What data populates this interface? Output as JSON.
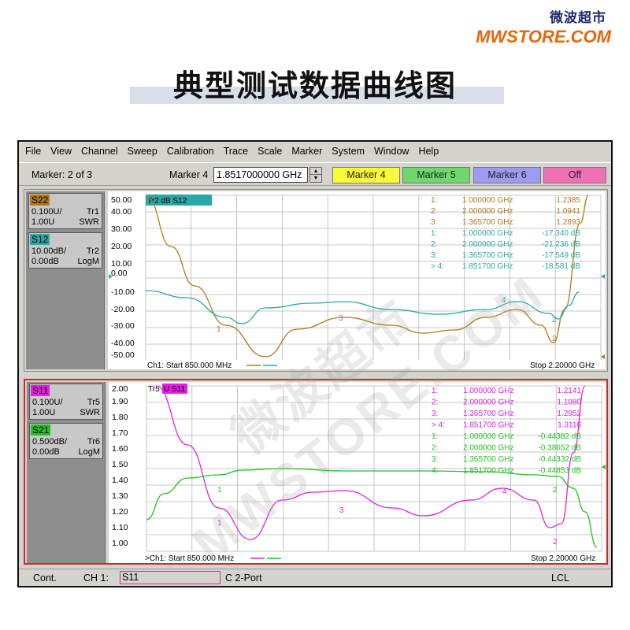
{
  "branding": {
    "name_cn": "微波超市",
    "name_en": "MWSTORE.COM"
  },
  "title": "典型测试数据曲线图",
  "menubar": [
    "File",
    "View",
    "Channel",
    "Sweep",
    "Calibration",
    "Trace",
    "Scale",
    "Marker",
    "System",
    "Window",
    "Help"
  ],
  "marker_bar": {
    "status": "Marker: 2 of 3",
    "label": "Marker 4",
    "value": "1.8517000000 GHz",
    "buttons": [
      "Marker 4",
      "Marker 5",
      "Marker 6",
      "Off"
    ]
  },
  "channel1": {
    "traces": [
      {
        "name": "S22",
        "scale": "0.100U/",
        "tr": "Tr1",
        "ref": "1.00U",
        "format": "SWR",
        "color": "#b07a1c"
      },
      {
        "name": "S12",
        "scale": "10.00dB/",
        "tr": "Tr2",
        "ref": "0.00dB",
        "format": "LogM",
        "color": "#2aa8a8"
      }
    ],
    "active_label": "Tr2 dB S12",
    "y_ticks": [
      "50.00",
      "40.00",
      "30.00",
      "20.00",
      "10.00",
      "0.00",
      "-10.00",
      "-20.00",
      "-30.00",
      "-40.00",
      "-50.00"
    ],
    "start": "Ch1: Start  850.000 MHz",
    "stop": "Stop  2.20000 GHz",
    "marker_readout": [
      {
        "id": "1:",
        "freq": "1.000000 GHz",
        "val": "1.2385",
        "color": "#b07a1c"
      },
      {
        "id": "2:",
        "freq": "2.000000 GHz",
        "val": "1.0941",
        "color": "#b07a1c"
      },
      {
        "id": "3:",
        "freq": "1.365700 GHz",
        "val": "1.2893",
        "color": "#b07a1c"
      },
      {
        "id": "1:",
        "freq": "1.000000 GHz",
        "val": "-17.340 dB",
        "color": "#2aa8a8"
      },
      {
        "id": "2:",
        "freq": "2.000000 GHz",
        "val": "-21.236 dB",
        "color": "#2aa8a8"
      },
      {
        "id": "3:",
        "freq": "1.365700 GHz",
        "val": "-17.549 dB",
        "color": "#2aa8a8"
      },
      {
        "id": "> 4:",
        "freq": "1.851700 GHz",
        "val": "-18.581 dB",
        "color": "#2aa8a8"
      }
    ],
    "marker_tags": [
      "1",
      "3",
      "4",
      "2",
      "2"
    ]
  },
  "channel2": {
    "traces": [
      {
        "name": "S11",
        "scale": "0.100U/",
        "tr": "Tr5",
        "ref": "1.00U",
        "format": "SWR",
        "color": "#e020e0"
      },
      {
        "name": "S21",
        "scale": "0.500dB/",
        "tr": "Tr6",
        "ref": "0.00dB",
        "format": "LogM",
        "color": "#22c022"
      }
    ],
    "active_label_a": "Tr5",
    "active_label_b": "U S11",
    "y_ticks": [
      "2.00",
      "1.90",
      "1.80",
      "1.70",
      "1.60",
      "1.50",
      "1.40",
      "1.30",
      "1.20",
      "1.10",
      "1.00"
    ],
    "start": ">Ch1: Start  850.000 MHz",
    "stop": "Stop  2.20000 GHz",
    "marker_readout": [
      {
        "id": "1:",
        "freq": "1.000000 GHz",
        "val": "1.2141",
        "color": "#e020e0"
      },
      {
        "id": "2:",
        "freq": "2.000000 GHz",
        "val": "1.1080",
        "color": "#e020e0"
      },
      {
        "id": "3:",
        "freq": "1.365700 GHz",
        "val": "1.2952",
        "color": "#e020e0"
      },
      {
        "id": "> 4:",
        "freq": "1.851700 GHz",
        "val": "1.3116",
        "color": "#e020e0"
      },
      {
        "id": "1:",
        "freq": "1.000000 GHz",
        "val": "-0.44382 dB",
        "color": "#22c022"
      },
      {
        "id": "2:",
        "freq": "2.000000 GHz",
        "val": "-0.38652 dB",
        "color": "#22c022"
      },
      {
        "id": "3:",
        "freq": "1.365700 GHz",
        "val": "-0.44332 dB",
        "color": "#22c022"
      },
      {
        "id": "4:",
        "freq": "1.851700 GHz",
        "val": "-0.44853 dB",
        "color": "#22c022"
      }
    ],
    "marker_tags": [
      "1",
      "3",
      "4",
      "2",
      "1",
      "2"
    ]
  },
  "statusbar": {
    "mode": "Cont.",
    "channel_label": "CH 1:",
    "channel_value": "S11",
    "cal": "C  2-Port",
    "lcl": "LCL"
  },
  "watermark": "微波超市\nMWSTORE.COM"
}
